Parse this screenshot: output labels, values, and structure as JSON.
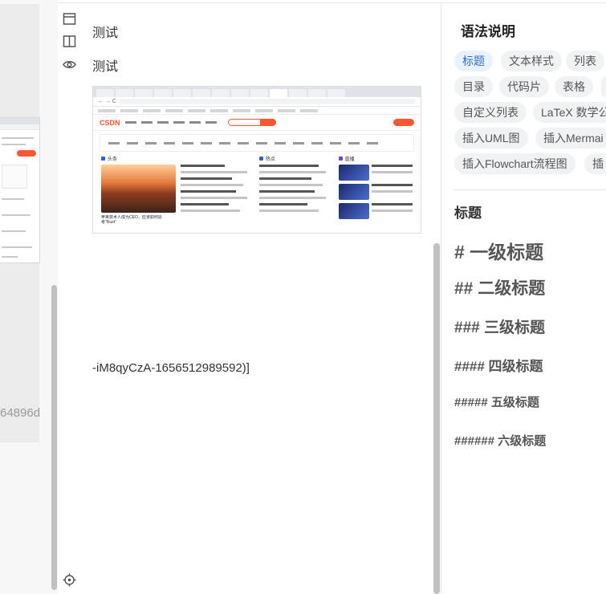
{
  "left_editor": {
    "visible_text": "64896d"
  },
  "preview": {
    "line1": "测试",
    "line2": "测试",
    "tail_text": "-iM8qyCzA-1656512989592)]",
    "embedded_image": {
      "logo": "CSDN",
      "sections": [
        "头条",
        "热点",
        "直播"
      ],
      "headline": "苹果技术人成为CEO，应该如何思考\"Rust\""
    }
  },
  "toolbar": {
    "icons": [
      "toggle-editor-icon",
      "split-view-icon",
      "preview-eye-icon",
      "sync-scroll-target-icon"
    ]
  },
  "help": {
    "title": "语法说明",
    "tags": [
      {
        "label": "标题",
        "active": true
      },
      {
        "label": "文本样式",
        "active": false
      },
      {
        "label": "列表",
        "active": false
      },
      {
        "label": "目录",
        "active": false
      },
      {
        "label": "代码片",
        "active": false
      },
      {
        "label": "表格",
        "active": false
      },
      {
        "label": "自定义列表",
        "active": false
      },
      {
        "label": "LaTeX 数学公",
        "active": false
      },
      {
        "label": "插入UML图",
        "active": false
      },
      {
        "label": "插入Mermai",
        "active": false
      },
      {
        "label": "插入Flowchart流程图",
        "active": false
      },
      {
        "label": "插",
        "active": false
      }
    ],
    "section_title": "标题",
    "headings": [
      "# 一级标题",
      "## 二级标题",
      "### 三级标题",
      "#### 四级标题",
      "##### 五级标题",
      "###### 六级标题"
    ],
    "colors": {
      "active_tag_bg": "#e8f1fc",
      "active_tag_text": "#3270c7",
      "tag_bg": "#f0f2f5"
    }
  }
}
